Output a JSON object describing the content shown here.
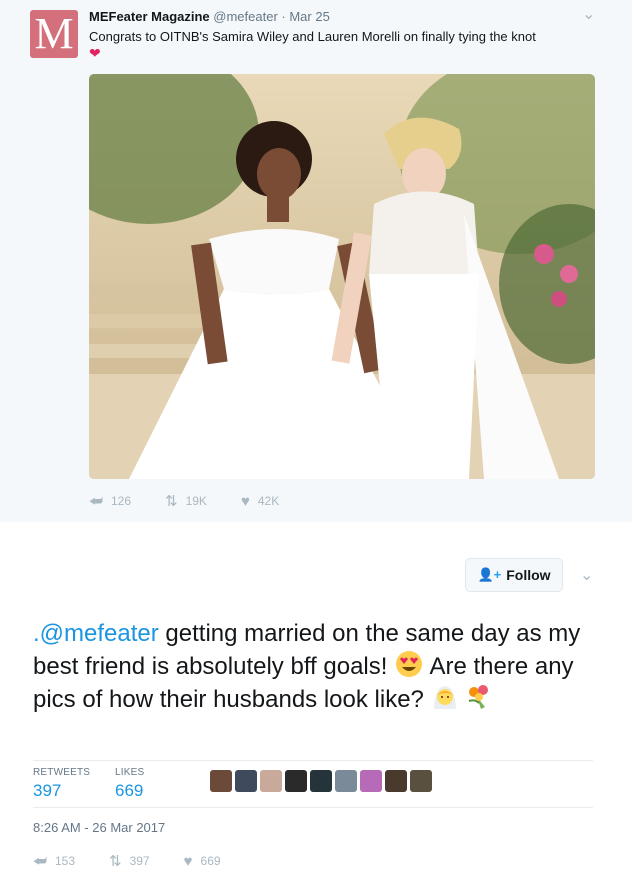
{
  "quoted_tweet": {
    "avatar_letter": "M",
    "author_name": "MEFeater Magazine",
    "handle": "@mefeater",
    "date": "· Mar 25",
    "text": "Congrats to OITNB's Samira Wiley and Lauren Morelli on finally tying the knot",
    "emoji": "heart",
    "actions": {
      "replies": "126",
      "retweets": "19K",
      "likes": "42K"
    }
  },
  "main_tweet": {
    "follow_label": "Follow",
    "mention": ".@mefeater",
    "text_rest": " getting married on the same day as my best friend is absolutely bff goals!",
    "text_line2": " Are there any pics of how their husbands look like?",
    "emojis": [
      "heart-eyes",
      "bride",
      "bouquet"
    ],
    "stats": {
      "retweets_label": "RETWEETS",
      "retweets": "397",
      "likes_label": "LIKES",
      "likes": "669"
    },
    "liker_avatar_colors": [
      "#6b4a3a",
      "#3f4a5c",
      "#c8a99a",
      "#2a2a2a",
      "#24343a",
      "#7a8a98",
      "#b76ab8",
      "#4a3a2e",
      "#5a5040"
    ],
    "timestamp": "8:26 AM - 26 Mar 2017",
    "actions": {
      "replies": "153",
      "retweets": "397",
      "likes": "669"
    }
  },
  "icons": {
    "reply": "reply-icon",
    "retweet": "retweet-icon",
    "like": "heart-icon",
    "caret": "chevron-down-icon",
    "follow": "add-user-icon"
  },
  "colors": {
    "brand_blue": "#1da1f2",
    "link_blue": "#1b95e0",
    "heart_red": "#e0245e",
    "avatar_pink": "#d4707c"
  }
}
